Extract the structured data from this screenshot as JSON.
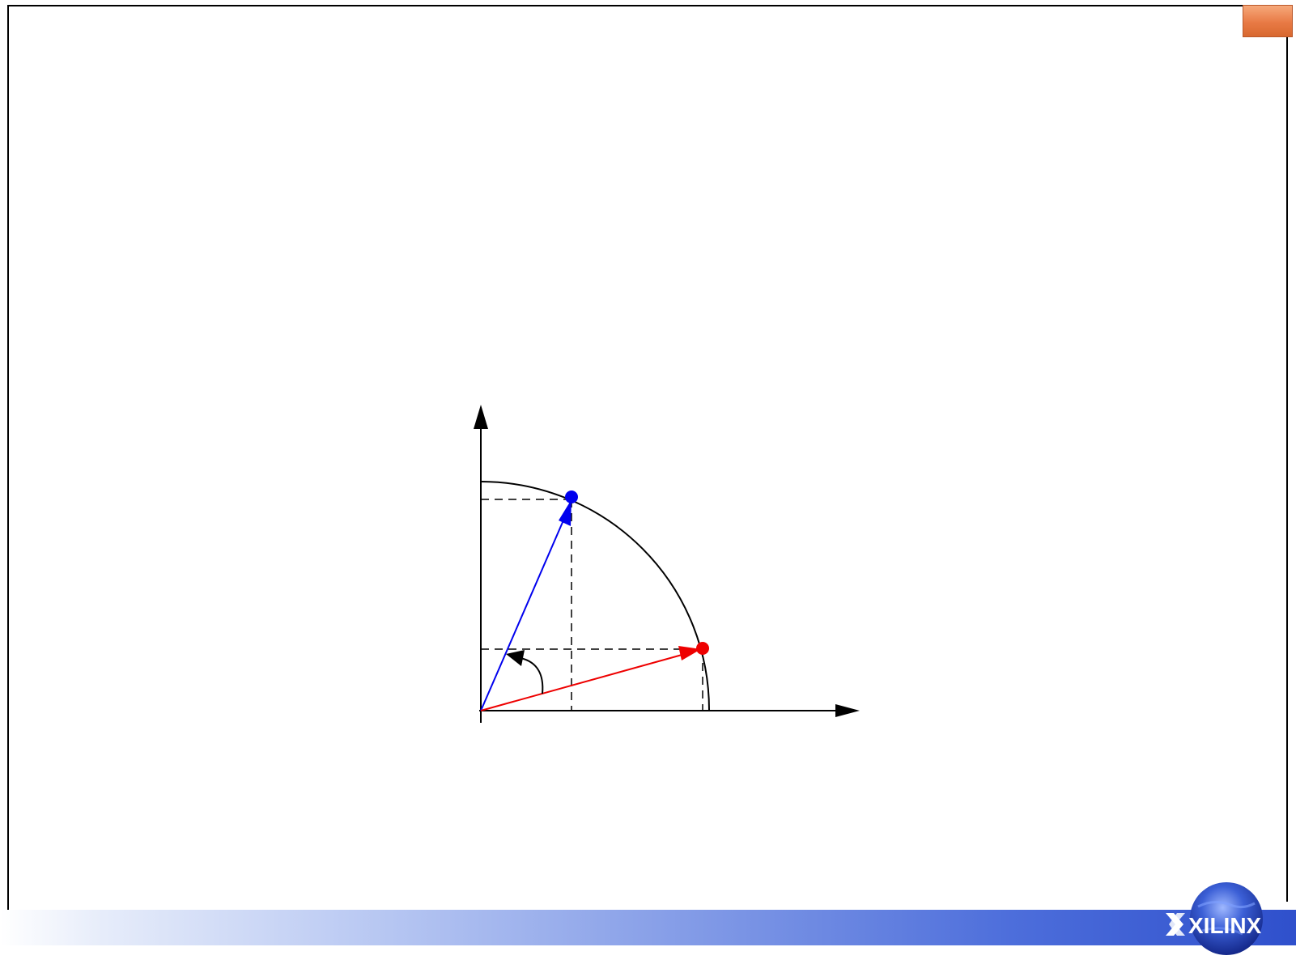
{
  "logo": {
    "text": "XILINX",
    "icon": "xilinx-globe-logo"
  },
  "diagram": {
    "type": "vector-rotation",
    "vectors": [
      {
        "name": "rotated-vector",
        "color": "#0000ee"
      },
      {
        "name": "original-vector",
        "color": "#ee0000"
      }
    ],
    "axes": [
      "x-axis",
      "y-axis"
    ],
    "arc": "unit-circle-quarter",
    "rotation_arrow": "counterclockwise"
  }
}
